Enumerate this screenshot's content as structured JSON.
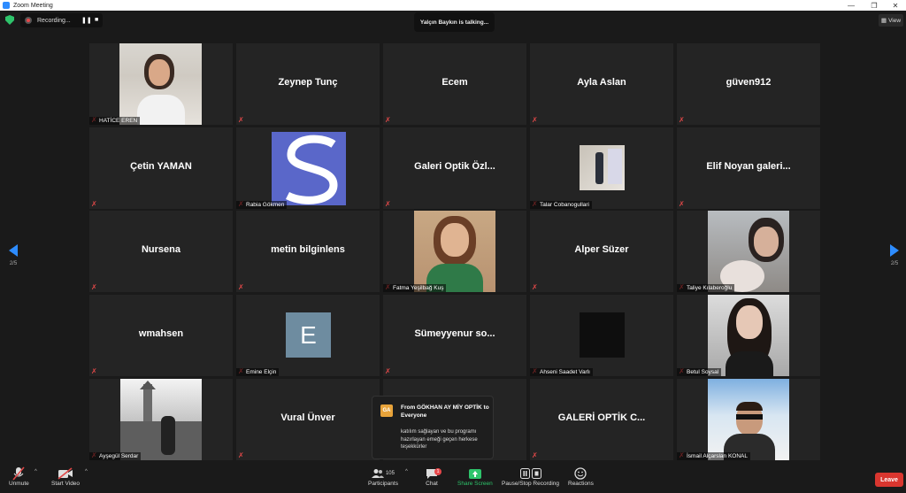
{
  "window": {
    "title": "Zoom Meeting"
  },
  "topbar": {
    "recording_label": "Recording...",
    "pause_icon": "❚❚",
    "stop_icon": "■",
    "talking": "Yalçın Baykın is talking...",
    "view_label": "View"
  },
  "pager": {
    "left": "2/5",
    "right": "2/5"
  },
  "tiles": [
    {
      "name": "",
      "label": "HATİCE EREN"
    },
    {
      "name": "Zeynep Tunç",
      "label": ""
    },
    {
      "name": "Ecem",
      "label": ""
    },
    {
      "name": "Ayla Aslan",
      "label": ""
    },
    {
      "name": "güven912",
      "label": ""
    },
    {
      "name": "Çetin YAMAN",
      "label": ""
    },
    {
      "name": "",
      "label": "Rabia Gökmen"
    },
    {
      "name": "Galeri Optik Özl...",
      "label": ""
    },
    {
      "name": "",
      "label": "Talar Cobanogullari"
    },
    {
      "name": "Elif Noyan galeri...",
      "label": ""
    },
    {
      "name": "Nursena",
      "label": ""
    },
    {
      "name": "metin bilginlens",
      "label": ""
    },
    {
      "name": "",
      "label": "Fatma Yeşilbağ Kuş"
    },
    {
      "name": "Alper Süzer",
      "label": ""
    },
    {
      "name": "",
      "label": "Taliye Kılaberoğlu"
    },
    {
      "name": "wmahsen",
      "label": ""
    },
    {
      "name": "",
      "label": "Emine Elçin",
      "avatar": "E"
    },
    {
      "name": "Sümeyyenur so...",
      "label": ""
    },
    {
      "name": "",
      "label": "Ahseni Saadet Varlı"
    },
    {
      "name": "",
      "label": "Betul Soysal"
    },
    {
      "name": "",
      "label": "Ayşegül Serdar"
    },
    {
      "name": "Vural Ünver",
      "label": ""
    },
    {
      "name": "",
      "label": ""
    },
    {
      "name": "GALERİ OPTİK C...",
      "label": ""
    },
    {
      "name": "",
      "label": "İsmail Alçarslan KONAL"
    }
  ],
  "chat_popup": {
    "initials": "GA",
    "from": "From GÖKHAN AY MİY OPTİK to Everyone",
    "message": "katılım sağlayan ve bu programı hazırlayan emeği geçen herkese teşekkürler"
  },
  "toolbar": {
    "unmute": "Unmute",
    "start_video": "Start Video",
    "participants": "Participants",
    "participants_count": "105",
    "chat": "Chat",
    "chat_badge": "1",
    "share_screen": "Share Screen",
    "recording": "Pause/Stop Recording",
    "reactions": "Reactions",
    "leave": "Leave"
  },
  "colors": {
    "accent": "#2d8cff",
    "share_green": "#2ec46b",
    "leave_red": "#d9362f",
    "mute_red": "#e04848"
  }
}
